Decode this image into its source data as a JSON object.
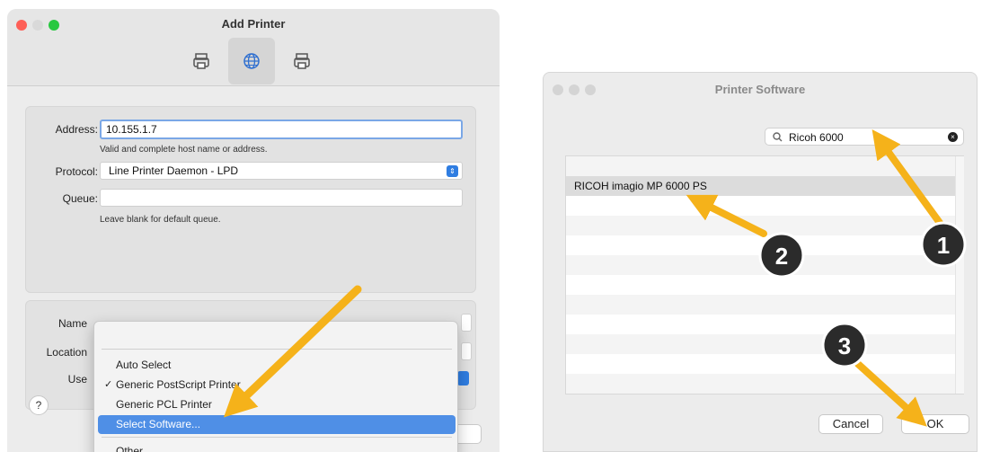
{
  "add_printer": {
    "title": "Add Printer",
    "address_label": "Address:",
    "address_value": "10.155.1.7",
    "address_hint": "Valid and complete host name or address.",
    "protocol_label": "Protocol:",
    "protocol_value": "Line Printer Daemon - LPD",
    "queue_label": "Queue:",
    "queue_value": "",
    "queue_hint": "Leave blank for default queue.",
    "name_label": "Name",
    "location_label": "Location",
    "use_label": "Use",
    "help_label": "?",
    "add_button_fragment": "d",
    "menu": {
      "items": [
        {
          "label": "Auto Select",
          "checked": false
        },
        {
          "label": "Generic PostScript Printer",
          "checked": true
        },
        {
          "label": "Generic PCL Printer",
          "checked": false
        },
        {
          "label": "Select Software...",
          "highlighted": true
        },
        {
          "label": "Other..."
        }
      ],
      "check_glyph": "✓"
    }
  },
  "printer_software": {
    "title": "Printer Software",
    "search_value": "Ricoh 6000",
    "results": [
      "RICOH imagio MP 6000 PS"
    ],
    "cancel_label": "Cancel",
    "ok_label": "OK"
  },
  "annotations": {
    "badges": [
      "1",
      "2",
      "3"
    ],
    "arrow_color": "#f5b21a"
  },
  "colors": {
    "accent": "#2f7de1",
    "highlight": "#4f8fe6",
    "close": "#fe5f57",
    "minimize": "#febc2e",
    "zoom": "#28c840"
  }
}
